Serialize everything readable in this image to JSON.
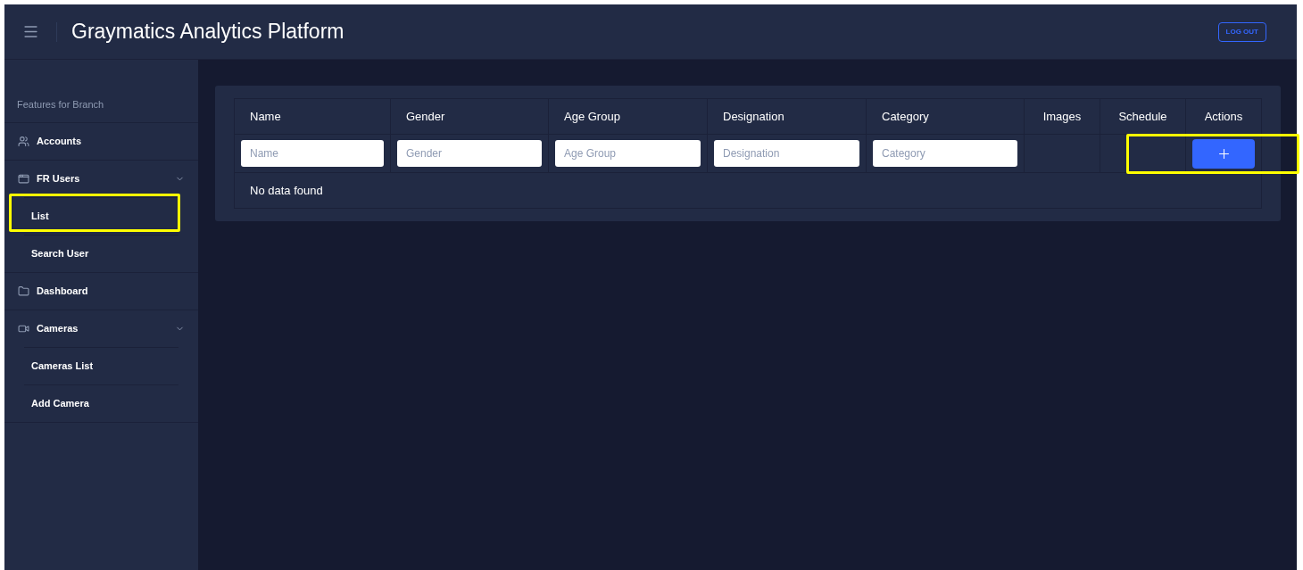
{
  "header": {
    "title": "Graymatics Analytics Platform",
    "logout": "LOG OUT"
  },
  "sidebar": {
    "heading": "Features for Branch",
    "items": [
      {
        "label": "Accounts"
      },
      {
        "label": "FR Users",
        "expanded": true,
        "children": [
          {
            "label": "List",
            "highlighted": true
          },
          {
            "label": "Search User",
            "highlighted": false
          }
        ]
      },
      {
        "label": "Dashboard"
      },
      {
        "label": "Cameras",
        "expanded": true,
        "children": [
          {
            "label": "Cameras List",
            "highlighted": false
          },
          {
            "label": "Add Camera",
            "highlighted": false
          }
        ]
      }
    ]
  },
  "table": {
    "columns": [
      {
        "label": "Name",
        "placeholder": "Name"
      },
      {
        "label": "Gender",
        "placeholder": "Gender"
      },
      {
        "label": "Age Group",
        "placeholder": "Age Group"
      },
      {
        "label": "Designation",
        "placeholder": "Designation"
      },
      {
        "label": "Category",
        "placeholder": "Category"
      },
      {
        "label": "Images"
      },
      {
        "label": "Schedule"
      },
      {
        "label": "Actions",
        "kind": "add"
      }
    ],
    "add_highlighted": true,
    "empty_message": "No data found"
  }
}
